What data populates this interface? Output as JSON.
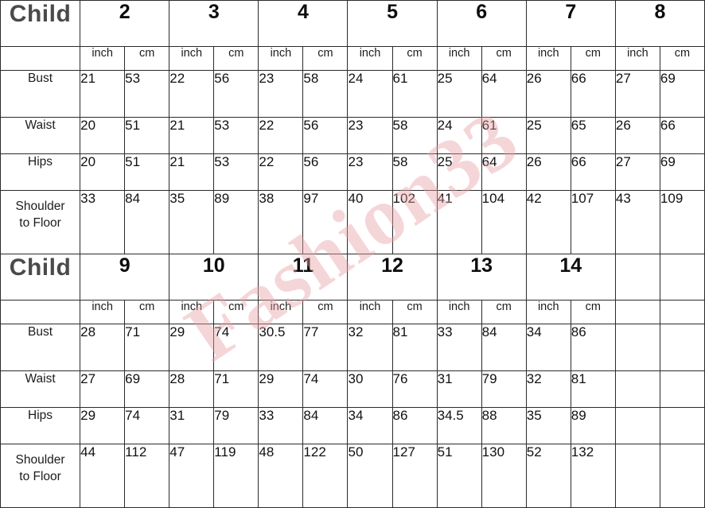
{
  "watermark": {
    "text": "Fashion33"
  },
  "colors": {
    "header_gray": "#cccccc",
    "cell_white": "#ffffff",
    "border": "#2b2b2b",
    "child_text": "#4a4a4a",
    "watermark": "#e8a0a4"
  },
  "units": {
    "inch": "inch",
    "cm": "cm"
  },
  "chart_data": {
    "type": "table",
    "title": "Child Size Chart",
    "tables": [
      {
        "corner_label": "Child",
        "sizes": [
          "2",
          "3",
          "4",
          "5",
          "6",
          "7",
          "8"
        ],
        "unit_headers": [
          "inch",
          "cm",
          "inch",
          "cm",
          "inch",
          "cm",
          "inch",
          "cm",
          "inch",
          "cm",
          "inch",
          "cm",
          "inch",
          "cm"
        ],
        "rows": [
          {
            "label": "Bust",
            "label_lines": [
              "Bust"
            ],
            "values": [
              "21",
              "53",
              "22",
              "56",
              "23",
              "58",
              "24",
              "61",
              "25",
              "64",
              "26",
              "66",
              "27",
              "69"
            ]
          },
          {
            "label": "Waist",
            "label_lines": [
              "Waist"
            ],
            "values": [
              "20",
              "51",
              "21",
              "53",
              "22",
              "56",
              "23",
              "58",
              "24",
              "61",
              "25",
              "65",
              "26",
              "66"
            ]
          },
          {
            "label": "Hips",
            "label_lines": [
              "Hips"
            ],
            "values": [
              "20",
              "51",
              "21",
              "53",
              "22",
              "56",
              "23",
              "58",
              "25",
              "64",
              "26",
              "66",
              "27",
              "69"
            ]
          },
          {
            "label": "Shoulder to Floor",
            "label_lines": [
              "Shoulder",
              "to Floor"
            ],
            "values": [
              "33",
              "84",
              "35",
              "89",
              "38",
              "97",
              "40",
              "102",
              "41",
              "104",
              "42",
              "107",
              "43",
              "109"
            ]
          }
        ]
      },
      {
        "corner_label": "Child",
        "sizes": [
          "9",
          "10",
          "11",
          "12",
          "13",
          "14"
        ],
        "unit_headers": [
          "inch",
          "cm",
          "inch",
          "cm",
          "inch",
          "cm",
          "inch",
          "cm",
          "inch",
          "cm",
          "inch",
          "cm"
        ],
        "rows": [
          {
            "label": "Bust",
            "label_lines": [
              "Bust"
            ],
            "values": [
              "28",
              "71",
              "29",
              "74",
              "30.5",
              "77",
              "32",
              "81",
              "33",
              "84",
              "34",
              "86"
            ]
          },
          {
            "label": "Waist",
            "label_lines": [
              "Waist"
            ],
            "values": [
              "27",
              "69",
              "28",
              "71",
              "29",
              "74",
              "30",
              "76",
              "31",
              "79",
              "32",
              "81"
            ]
          },
          {
            "label": "Hips",
            "label_lines": [
              "Hips"
            ],
            "values": [
              "29",
              "74",
              "31",
              "79",
              "33",
              "84",
              "34",
              "86",
              "34.5",
              "88",
              "35",
              "89"
            ]
          },
          {
            "label": "Shoulder to Floor",
            "label_lines": [
              "Shoulder",
              "to Floor"
            ],
            "values": [
              "44",
              "112",
              "47",
              "119",
              "48",
              "122",
              "50",
              "127",
              "51",
              "130",
              "52",
              "132"
            ]
          }
        ]
      }
    ]
  }
}
